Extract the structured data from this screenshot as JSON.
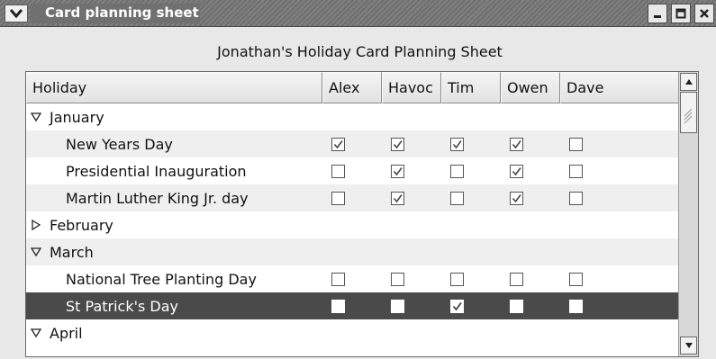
{
  "window": {
    "title": "Card planning sheet",
    "menu_icon": "chevron-down-icon",
    "buttons": [
      "minimize",
      "maximize",
      "close"
    ]
  },
  "sheet": {
    "title": "Jonathan's Holiday Card Planning Sheet"
  },
  "columns": [
    "Holiday",
    "Alex",
    "Havoc",
    "Tim",
    "Owen",
    "Dave"
  ],
  "rows": [
    {
      "label": "January",
      "type": "group",
      "expanded": true,
      "checks": null
    },
    {
      "label": "New Years Day",
      "type": "item",
      "checks": [
        true,
        true,
        true,
        true,
        false
      ]
    },
    {
      "label": "Presidential Inauguration",
      "type": "item",
      "checks": [
        false,
        true,
        false,
        true,
        false
      ]
    },
    {
      "label": "Martin Luther King Jr. day",
      "type": "item",
      "checks": [
        false,
        true,
        false,
        true,
        false
      ]
    },
    {
      "label": "February",
      "type": "group",
      "expanded": false,
      "checks": null
    },
    {
      "label": "March",
      "type": "group",
      "expanded": true,
      "checks": null
    },
    {
      "label": "National Tree Planting Day",
      "type": "item",
      "checks": [
        false,
        false,
        false,
        false,
        false
      ]
    },
    {
      "label": "St Patrick's Day",
      "type": "item",
      "selected": true,
      "checks": [
        false,
        false,
        true,
        false,
        false
      ]
    },
    {
      "label": "April",
      "type": "group",
      "expanded": true,
      "checks": null
    }
  ],
  "colors": {
    "selected_row": "#4a4a4a",
    "alt_row": "#efefef"
  }
}
